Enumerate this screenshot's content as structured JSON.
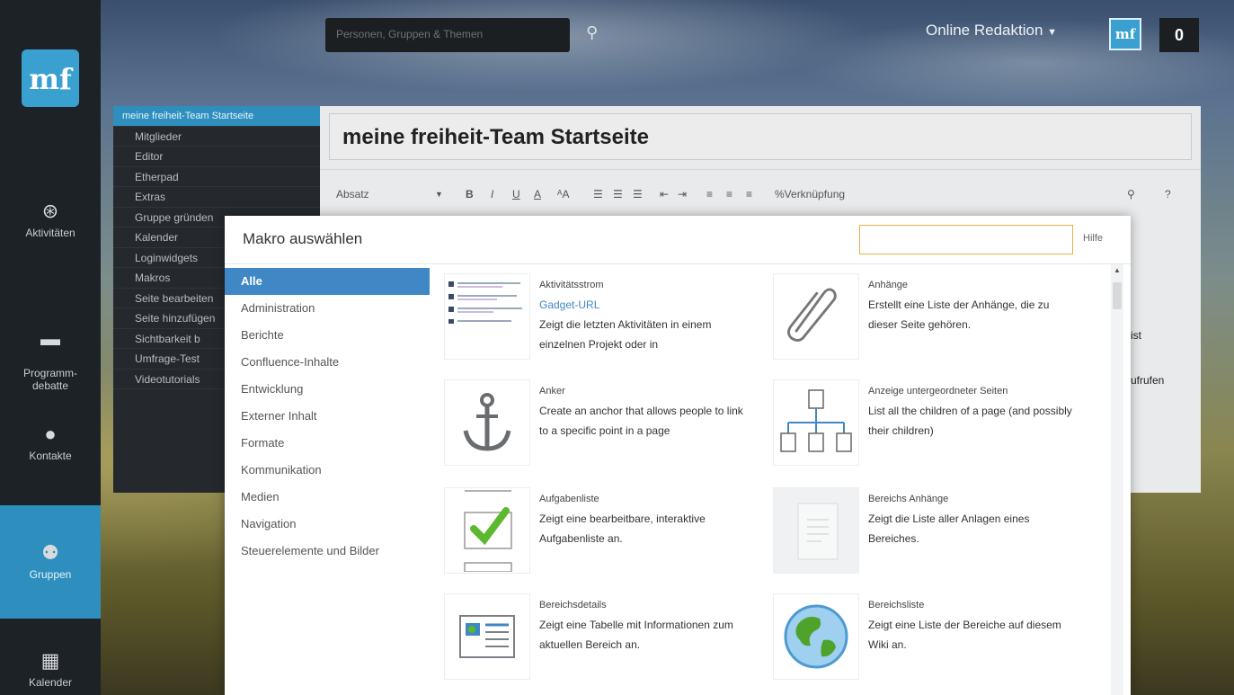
{
  "app": {
    "logo_text": "mf",
    "search_placeholder": "Personen, Gruppen & Themen",
    "user_menu_label": "Online Redaktion",
    "avatar_text": "mf",
    "notification_count": "0"
  },
  "leftnav": [
    {
      "label": "Aktivitäten",
      "icon": "activity-icon",
      "glyph": "⊛"
    },
    {
      "label": "Programm-\ndebatte",
      "icon": "chat-icon",
      "glyph": "▬"
    },
    {
      "label": "Kontakte",
      "icon": "contacts-icon",
      "glyph": "●"
    },
    {
      "label": "Gruppen",
      "icon": "groups-icon",
      "glyph": "⚉",
      "active": true
    },
    {
      "label": "Kalender",
      "icon": "calendar-icon",
      "glyph": "▦"
    }
  ],
  "submenu": {
    "header": "meine freiheit-Team Startseite",
    "items": [
      "Mitglieder",
      "Editor",
      "Etherpad",
      "Extras",
      "Gruppe gründen",
      "Kalender",
      "Loginwidgets",
      "Makros",
      "Seite bearbeiten",
      "Seite hinzufügen",
      "Sichtbarkeit b",
      "Umfrage-Test",
      "Videotutorials"
    ]
  },
  "editor": {
    "page_title": "meine freiheit-Team Startseite",
    "format_select": "Absatz",
    "link_button": "Verknüpfung",
    "help_button": "?",
    "side_text_1": "ist",
    "side_text_2": "ufrufen"
  },
  "modal": {
    "title": "Makro auswählen",
    "search_value": "",
    "help_label": "Hilfe",
    "categories": [
      "Alle",
      "Administration",
      "Berichte",
      "Confluence-Inhalte",
      "Entwicklung",
      "Externer Inhalt",
      "Formate",
      "Kommunikation",
      "Medien",
      "Navigation",
      "Steuerelemente und Bilder"
    ],
    "macros": [
      {
        "name": "Aktivitätsstrom",
        "link": "Gadget-URL",
        "desc": "Zeigt die letzten Aktivitäten in einem einzelnen Projekt oder in",
        "icon": "activity-stream-icon"
      },
      {
        "name": "Anhänge",
        "link": "",
        "desc": "Erstellt eine Liste der Anhänge, die zu dieser Seite gehören.",
        "icon": "paperclip-icon"
      },
      {
        "name": "Anker",
        "link": "",
        "desc": "Create an anchor that allows people to link to a specific point in a page",
        "icon": "anchor-icon"
      },
      {
        "name": "Anzeige untergeordneter Seiten",
        "link": "",
        "desc": "List all the children of a page (and possibly their children)",
        "icon": "page-tree-icon"
      },
      {
        "name": "Aufgabenliste",
        "link": "",
        "desc": "Zeigt eine bearbeitbare, interaktive Aufgabenliste an.",
        "icon": "checklist-icon"
      },
      {
        "name": "Bereichs Anhänge",
        "link": "",
        "desc": "Zeigt die Liste aller Anlagen eines Bereiches.",
        "icon": "document-icon"
      },
      {
        "name": "Bereichsdetails",
        "link": "",
        "desc": "Zeigt eine Tabelle mit Informationen zum aktuellen Bereich an.",
        "icon": "space-details-icon"
      },
      {
        "name": "Bereichsliste",
        "link": "",
        "desc": "Zeigt eine Liste der Bereiche auf diesem Wiki an.",
        "icon": "globe-icon"
      }
    ]
  }
}
